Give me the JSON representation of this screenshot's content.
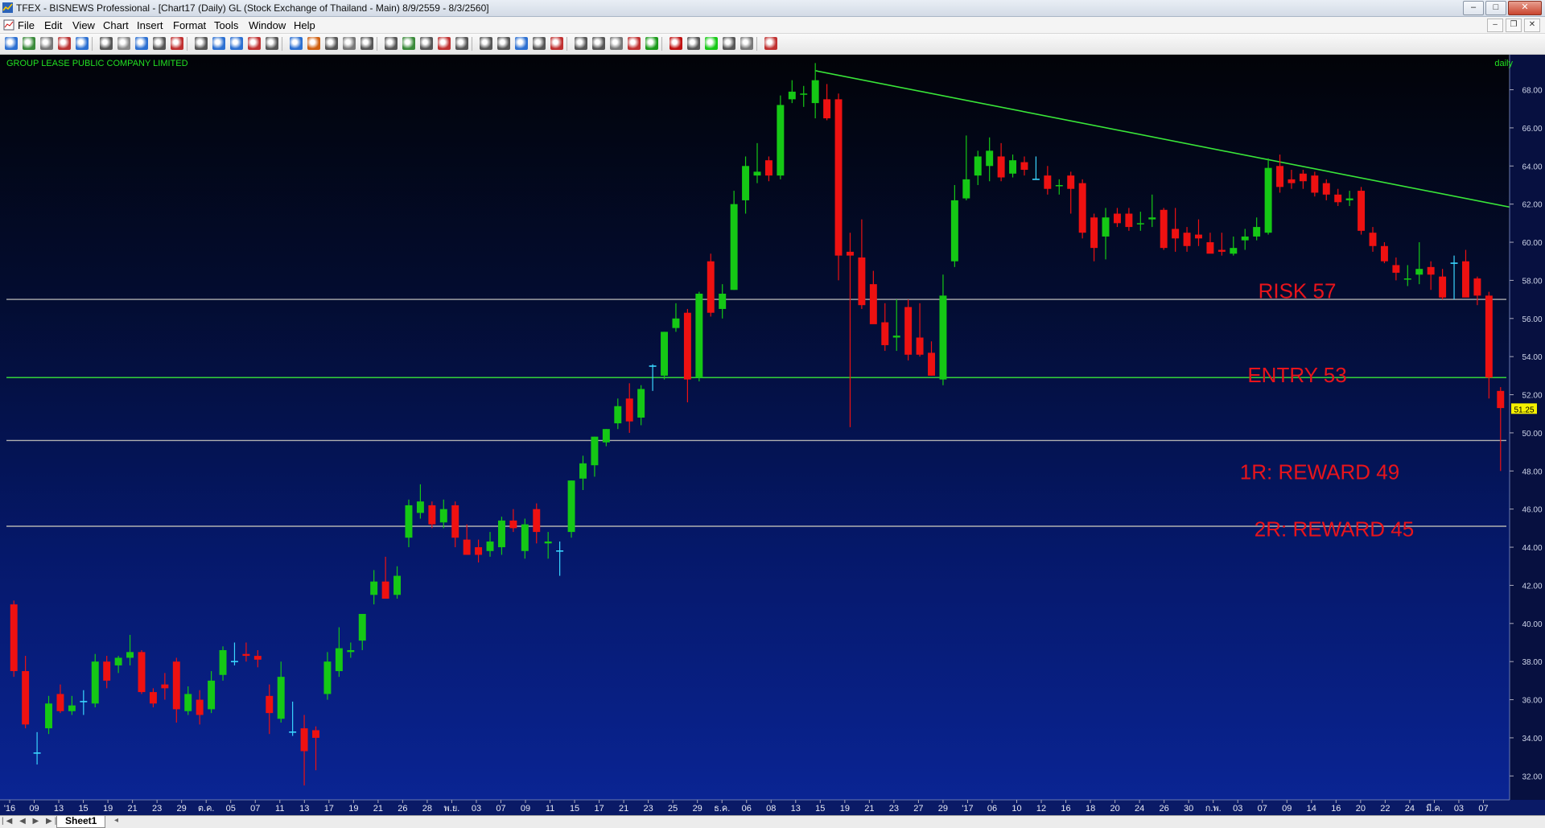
{
  "window": {
    "title": "TFEX - BISNEWS Professional - [Chart17 (Daily)  GL (Stock Exchange of Thailand - Main) 8/9/2559 - 8/3/2560]",
    "minimize": "–",
    "maximize": "□",
    "close": "✕"
  },
  "menu": [
    "File",
    "Edit",
    "View",
    "Chart",
    "Insert",
    "Format",
    "Tools",
    "Window",
    "Help"
  ],
  "mdi_controls": [
    "–",
    "❐",
    "✕"
  ],
  "chart": {
    "company": "GROUP LEASE PUBLIC COMPANY LIMITED",
    "interval": "daily",
    "last_price": "51.25"
  },
  "status": {
    "sheet_tab": "Sheet1",
    "nav": "|◀ ◀ ▶ ▶|"
  },
  "colors": {
    "up": "#15c815",
    "down": "#ee1111",
    "cross": "#3ad6ff",
    "trend": "#39e639",
    "levels": "#b0b0b0",
    "annotation": "#e8141b"
  },
  "chart_data": {
    "type": "candlestick",
    "ylim": [
      31,
      69.5
    ],
    "y_ticks": [
      "32.00",
      "34.00",
      "36.00",
      "38.00",
      "40.00",
      "42.00",
      "44.00",
      "46.00",
      "48.00",
      "50.00",
      "52.00",
      "54.00",
      "56.00",
      "58.00",
      "60.00",
      "62.00",
      "64.00",
      "66.00",
      "68.00"
    ],
    "x_labels": [
      "'16",
      "09",
      "13",
      "15",
      "19",
      "21",
      "23",
      "29",
      "ต.ค.",
      "05",
      "07",
      "11",
      "13",
      "17",
      "19",
      "21",
      "26",
      "28",
      "พ.ย.",
      "03",
      "07",
      "09",
      "11",
      "15",
      "17",
      "21",
      "23",
      "25",
      "29",
      "ธ.ค.",
      "06",
      "08",
      "13",
      "15",
      "19",
      "21",
      "23",
      "27",
      "29",
      "'17",
      "06",
      "10",
      "12",
      "16",
      "18",
      "20",
      "24",
      "26",
      "30",
      "ก.พ.",
      "03",
      "07",
      "09",
      "14",
      "16",
      "20",
      "22",
      "24",
      "มี.ค.",
      "03",
      "07"
    ],
    "candles": [
      [
        41,
        41.2,
        37.2,
        37.5
      ],
      [
        37.5,
        38.3,
        34.5,
        34.7
      ],
      [
        33.5,
        34.3,
        32.6,
        33.2
      ],
      [
        34.5,
        36.2,
        34.2,
        35.8
      ],
      [
        36.3,
        36.8,
        35.3,
        35.4
      ],
      [
        35.4,
        36.2,
        35.2,
        35.7
      ],
      [
        35.7,
        36.5,
        35.2,
        35.9
      ],
      [
        35.8,
        38.4,
        35.6,
        38
      ],
      [
        38,
        38.3,
        36.6,
        37
      ],
      [
        37.8,
        38.3,
        37.4,
        38.2
      ],
      [
        38.2,
        39.4,
        37.8,
        38.5
      ],
      [
        38.5,
        38.6,
        36.3,
        36.4
      ],
      [
        36.4,
        36.6,
        35.6,
        35.8
      ],
      [
        36.8,
        37.4,
        36,
        36.6
      ],
      [
        38,
        38.2,
        34.8,
        35.5
      ],
      [
        35.4,
        36.7,
        35.2,
        36.3
      ],
      [
        36,
        36.5,
        34.7,
        35.2
      ],
      [
        35.5,
        37.5,
        35.3,
        37
      ],
      [
        37.3,
        38.8,
        37,
        38.6
      ],
      [
        38.7,
        39,
        37.8,
        38
      ],
      [
        38.4,
        39,
        38,
        38.3
      ],
      [
        38.3,
        38.6,
        37.7,
        38.1
      ],
      [
        36.2,
        36.8,
        34.2,
        35.3
      ],
      [
        35,
        38,
        34.8,
        37.2
      ],
      [
        35.2,
        35.9,
        34.1,
        34.3
      ],
      [
        34.5,
        35.2,
        31.5,
        33.3
      ],
      [
        34.4,
        34.6,
        32.3,
        34
      ],
      [
        36.3,
        38.5,
        36,
        38
      ],
      [
        37.5,
        39.8,
        37.2,
        38.7
      ],
      [
        38.5,
        39,
        38.2,
        38.6
      ],
      [
        39.1,
        40.2,
        38.6,
        40.5
      ],
      [
        41.5,
        42.8,
        41,
        42.2
      ],
      [
        42.2,
        43.5,
        41.5,
        41.3
      ],
      [
        41.5,
        43,
        41.3,
        42.5
      ],
      [
        44.5,
        46.5,
        44,
        46.2
      ],
      [
        45.8,
        47.3,
        45.5,
        46.4
      ],
      [
        46.2,
        46.4,
        45,
        45.2
      ],
      [
        45.3,
        46.5,
        45,
        46
      ],
      [
        46.2,
        46.4,
        44,
        44.5
      ],
      [
        44.4,
        45.2,
        43.8,
        43.6
      ],
      [
        44,
        44.4,
        43.2,
        43.6
      ],
      [
        43.8,
        44.8,
        43.5,
        44.3
      ],
      [
        44,
        45.6,
        43.6,
        45.4
      ],
      [
        45.4,
        46,
        44.8,
        45
      ],
      [
        43.8,
        45.5,
        43.4,
        45.2
      ],
      [
        46,
        46.3,
        44.2,
        44.8
      ],
      [
        44.2,
        44.8,
        43.4,
        44.3
      ],
      [
        44.2,
        44.3,
        42.5,
        43.8
      ],
      [
        44.8,
        47.5,
        44.5,
        47.5
      ],
      [
        47.6,
        48.8,
        47,
        48.4
      ],
      [
        48.3,
        49.8,
        47.7,
        49.8
      ],
      [
        49.5,
        50.2,
        49.3,
        50.2
      ],
      [
        50.5,
        51.8,
        50.2,
        51.4
      ],
      [
        51.8,
        52.6,
        50,
        50.6
      ],
      [
        50.8,
        52.5,
        50.4,
        52.3
      ],
      [
        52.5,
        53.6,
        52.2,
        53.5
      ],
      [
        53,
        55.3,
        52.8,
        55.3
      ],
      [
        55.5,
        56.8,
        55.3,
        56
      ],
      [
        56.3,
        56.5,
        51.6,
        52.8
      ],
      [
        52.9,
        57.4,
        52.7,
        57.3
      ],
      [
        59,
        59.4,
        56.1,
        56.3
      ],
      [
        56.5,
        57.8,
        56,
        57.3
      ],
      [
        57.5,
        62.7,
        57.5,
        62
      ],
      [
        62.2,
        64.5,
        61.5,
        64
      ],
      [
        63.5,
        65.2,
        63.1,
        63.7
      ],
      [
        64.3,
        64.5,
        63.2,
        63.5
      ],
      [
        63.5,
        67.7,
        63.3,
        67.2
      ],
      [
        67.5,
        68.5,
        67.3,
        67.9
      ],
      [
        67.8,
        68.2,
        67.1,
        67.8
      ],
      [
        67.3,
        69.4,
        66.5,
        68.5
      ],
      [
        67.5,
        68.3,
        66.4,
        66.5
      ],
      [
        67.5,
        67.8,
        58,
        59.3
      ],
      [
        59.5,
        60.5,
        50.3,
        59.3
      ],
      [
        59.2,
        61.2,
        56.5,
        56.7
      ],
      [
        57.8,
        58.5,
        56,
        55.7
      ],
      [
        55.8,
        56.8,
        54.3,
        54.6
      ],
      [
        55,
        57,
        54.3,
        55.1
      ],
      [
        56.6,
        57,
        53.8,
        54.1
      ],
      [
        55,
        56.8,
        54,
        54.1
      ],
      [
        54.2,
        54.8,
        53,
        53
      ],
      [
        52.8,
        58.3,
        52.5,
        57.2
      ],
      [
        59,
        63,
        58.7,
        62.2
      ],
      [
        62.3,
        65.6,
        62.2,
        63.3
      ],
      [
        63.5,
        64.8,
        63,
        64.5
      ],
      [
        64,
        65.5,
        63.2,
        64.8
      ],
      [
        64.5,
        65.2,
        63.2,
        63.4
      ],
      [
        63.6,
        64.6,
        63.4,
        64.3
      ],
      [
        64.2,
        64.5,
        63.5,
        63.8
      ],
      [
        64.3,
        64.5,
        63.3,
        63.3
      ],
      [
        63.5,
        64,
        62.5,
        62.8
      ],
      [
        63,
        63.3,
        62.5,
        63
      ],
      [
        63.5,
        63.7,
        61.5,
        62.8
      ],
      [
        63.1,
        63.3,
        60.2,
        60.5
      ],
      [
        61.3,
        61.5,
        59,
        59.7
      ],
      [
        60.3,
        61.8,
        59.1,
        61.3
      ],
      [
        61.5,
        61.8,
        60.8,
        61
      ],
      [
        61.5,
        61.8,
        60.6,
        60.8
      ],
      [
        61,
        61.6,
        60.6,
        61
      ],
      [
        61.2,
        62.5,
        60.8,
        61.3
      ],
      [
        61.7,
        61.8,
        59.6,
        59.7
      ],
      [
        60.7,
        61.8,
        59.5,
        60.2
      ],
      [
        60.5,
        60.8,
        59.5,
        59.8
      ],
      [
        60.4,
        61.2,
        59.8,
        60.2
      ],
      [
        60,
        60.5,
        59.5,
        59.4
      ],
      [
        59.6,
        60.5,
        59.3,
        59.5
      ],
      [
        59.4,
        60.3,
        59.3,
        59.7
      ],
      [
        60.1,
        60.7,
        59.6,
        60.3
      ],
      [
        60.3,
        61.3,
        60.1,
        60.8
      ],
      [
        60.5,
        64.4,
        60.4,
        63.9
      ],
      [
        64,
        64.6,
        62.6,
        62.9
      ],
      [
        63.3,
        63.8,
        62.8,
        63.1
      ],
      [
        63.6,
        63.8,
        62.8,
        63.2
      ],
      [
        63.5,
        63.7,
        62.4,
        62.6
      ],
      [
        63.1,
        63.3,
        62.2,
        62.5
      ],
      [
        62.5,
        62.8,
        61.9,
        62.1
      ],
      [
        62.2,
        62.7,
        61.9,
        62.3
      ],
      [
        62.7,
        62.9,
        60.4,
        60.6
      ],
      [
        60.5,
        60.8,
        59.5,
        59.8
      ],
      [
        59.8,
        60,
        58.9,
        59.0
      ],
      [
        58.8,
        59.2,
        58,
        58.4
      ],
      [
        58.1,
        58.8,
        57.7,
        58.1
      ],
      [
        58.3,
        60,
        57.8,
        58.6
      ],
      [
        58.7,
        59,
        57.5,
        58.3
      ],
      [
        58.2,
        58.6,
        57,
        57.1
      ],
      [
        57.2,
        59.3,
        57,
        58.9
      ],
      [
        59,
        59.6,
        57.2,
        57.1
      ],
      [
        58.1,
        58.2,
        56.7,
        57.2
      ],
      [
        57.2,
        57.4,
        51.8,
        52.9
      ],
      [
        52.2,
        52.4,
        48,
        51.3
      ]
    ],
    "cross_indices": [
      2,
      6,
      19,
      24,
      47,
      55,
      88,
      124
    ],
    "horizontal_levels": [
      {
        "value": 57.0,
        "style": "gray"
      },
      {
        "value": 52.9,
        "style": "green"
      },
      {
        "value": 49.6,
        "style": "gray"
      },
      {
        "value": 45.1,
        "style": "gray"
      }
    ],
    "trendline": {
      "from_index": 69,
      "from_value": 69.0,
      "to_index": 135,
      "to_value": 61.1
    },
    "annotations": [
      {
        "text": "RISK 57",
        "value": 57.4
      },
      {
        "text": "ENTRY 53",
        "value": 53.0
      },
      {
        "text": "1R: REWARD 49",
        "value": 47.9
      },
      {
        "text": "2R: REWARD 45",
        "value": 44.9
      }
    ]
  }
}
